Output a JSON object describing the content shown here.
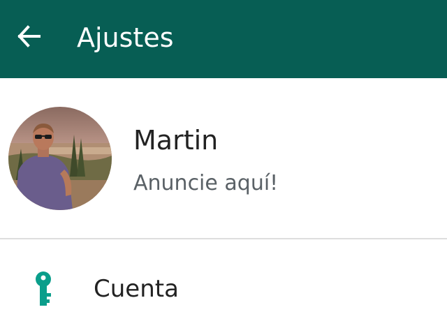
{
  "appbar": {
    "title": "Ajustes",
    "background_color": "#075e54",
    "back_icon": "arrow-left-icon"
  },
  "profile": {
    "name": "Martin",
    "status": "Anuncie aquí!"
  },
  "menu": {
    "items": [
      {
        "label": "Cuenta",
        "icon": "key-icon",
        "icon_color": "#0a9e8b"
      }
    ]
  }
}
